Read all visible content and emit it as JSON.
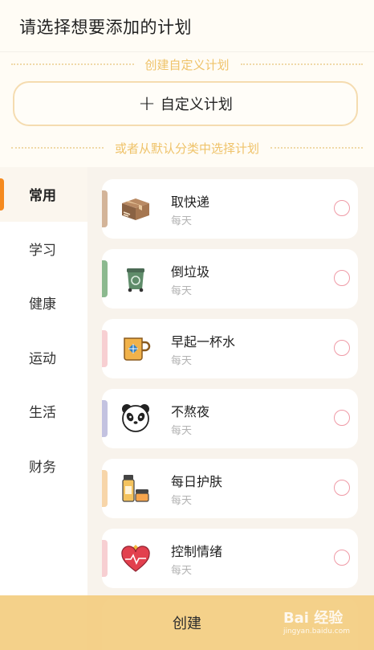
{
  "header": {
    "title": "请选择想要添加的计划"
  },
  "custom_section": {
    "label": "创建自定义计划",
    "button_label": "自定义计划"
  },
  "default_section": {
    "label": "或者从默认分类中选择计划"
  },
  "sidebar": {
    "items": [
      {
        "label": "常用",
        "active": true
      },
      {
        "label": "学习"
      },
      {
        "label": "健康"
      },
      {
        "label": "运动"
      },
      {
        "label": "生活"
      },
      {
        "label": "财务"
      }
    ]
  },
  "plans": [
    {
      "name": "取快递",
      "freq": "每天",
      "icon": "parcel-box-icon",
      "accent": "#d3b499"
    },
    {
      "name": "倒垃圾",
      "freq": "每天",
      "icon": "trash-bin-icon",
      "accent": "#8cb98f"
    },
    {
      "name": "早起一杯水",
      "freq": "每天",
      "icon": "water-cup-icon",
      "accent": "#f7cfd2"
    },
    {
      "name": "不熬夜",
      "freq": "每天",
      "icon": "panda-icon",
      "accent": "#c3c2e0"
    },
    {
      "name": "每日护肤",
      "freq": "每天",
      "icon": "skincare-icon",
      "accent": "#f7d5a9"
    },
    {
      "name": "控制情绪",
      "freq": "每天",
      "icon": "heart-icon",
      "accent": "#f7cfd2"
    }
  ],
  "footer": {
    "create_label": "创建"
  },
  "watermark": {
    "text": "Bai 经验",
    "sub": "jingyan.baidu.com"
  },
  "colors": {
    "accent": "#f58a1f",
    "divider_text": "#efc36a",
    "create_bar": "#f3cd80"
  }
}
